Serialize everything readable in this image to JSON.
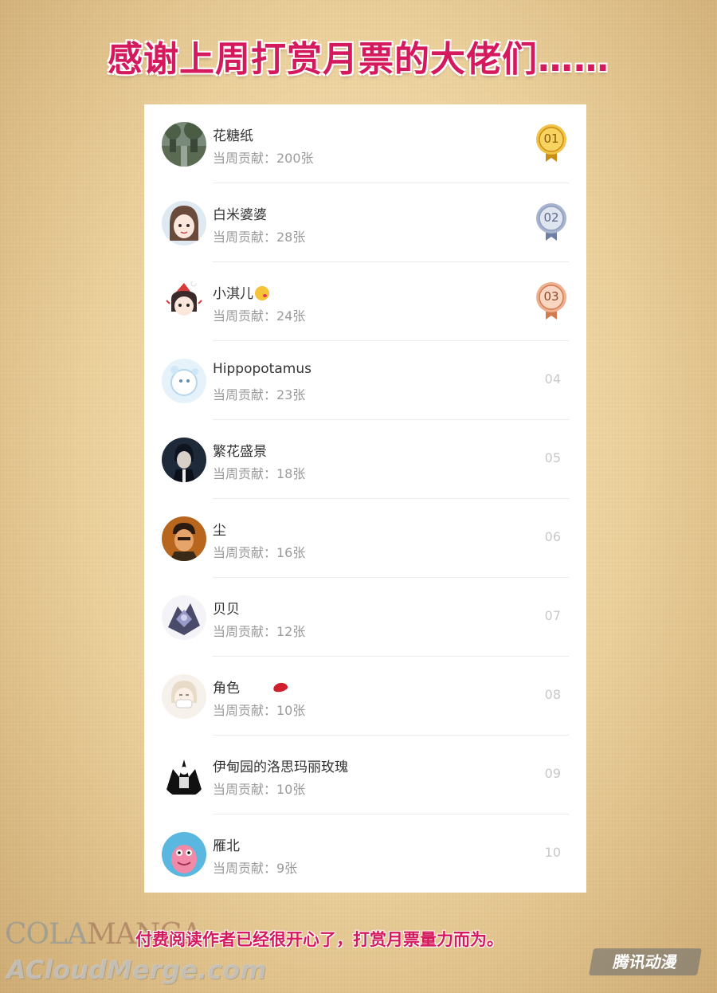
{
  "title": "感谢上周打赏月票的大佬们……",
  "contrib_prefix": "当周贡献：",
  "rows": [
    {
      "name": "花糖纸",
      "contrib": "当周贡献：200张",
      "rank": "01",
      "medal": "gold"
    },
    {
      "name": "白米婆婆",
      "contrib": "当周贡献：28张",
      "rank": "02",
      "medal": "silver"
    },
    {
      "name": "小淇儿",
      "contrib": "当周贡献：24张",
      "rank": "03",
      "medal": "bronze"
    },
    {
      "name": "Hippopotamus",
      "contrib": "当周贡献：23张",
      "rank": "04"
    },
    {
      "name": "繁花盛景",
      "contrib": "当周贡献：18张",
      "rank": "05"
    },
    {
      "name": "尘",
      "contrib": "当周贡献：16张",
      "rank": "06"
    },
    {
      "name": "贝贝",
      "contrib": "当周贡献：12张",
      "rank": "07"
    },
    {
      "name": "角色",
      "contrib": "当周贡献：10张",
      "rank": "08"
    },
    {
      "name": "伊甸园的洛思玛丽玫瑰",
      "contrib": "当周贡献：10张",
      "rank": "09"
    },
    {
      "name": "雁北",
      "contrib": "当周贡献：9张",
      "rank": "10"
    }
  ],
  "footer": "付费阅读作者已经很开心了，打赏月票量力而为。",
  "watermark": {
    "top_a": "COLA",
    "top_b": "MANGA",
    "bottom": "ACloudMerge.com",
    "logo": "腾讯动漫"
  },
  "colors": {
    "title": "#d4195c",
    "gold": "#e8b22a",
    "silver": "#8e9bbd",
    "bronze": "#e7a27d"
  }
}
